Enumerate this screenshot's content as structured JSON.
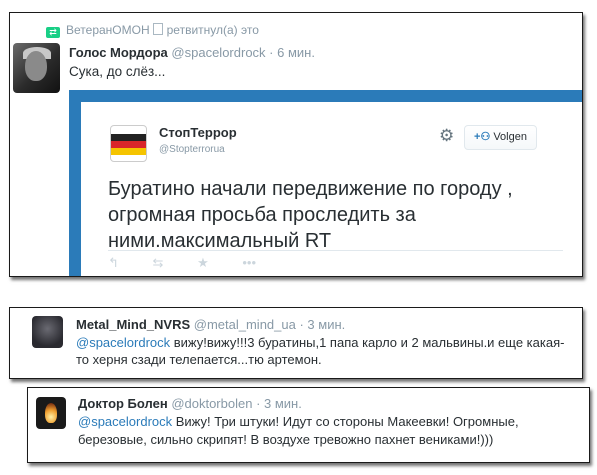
{
  "tweet1": {
    "retweeter_name": "ВетеранОМОН",
    "retweet_text": "ретвитнул(а) это",
    "author_name": "Голос Мордора",
    "author_handle": "@spacelordrock",
    "time": "· 6 мин.",
    "text": "Сука, до слёз..."
  },
  "embedded": {
    "author_name": "СтопТеррор",
    "author_handle": "@Stopterrorua",
    "follow_label": "Volgen",
    "text": "Буратино начали передвижение по городу , огромная просьба проследить за ними.максимальный RT",
    "icons": [
      "gear-icon",
      "add-user-icon",
      "reply-icon",
      "retweet-icon",
      "favorite-icon",
      "more-icon"
    ]
  },
  "tweet2": {
    "author_name": "Metal_Mind_NVRS",
    "author_handle": "@metal_mind_ua",
    "time": "· 3 мин.",
    "mention": "@spacelordrock",
    "text": " вижу!вижу!!!3 буратины,1 папа карло и 2 мальвины.и еще какая-то херня сзади телепается...тю артемон."
  },
  "tweet3": {
    "author_name": "Доктор Болен",
    "author_handle": "@doktorbolen",
    "time": "· 3 мин.",
    "mention": "@spacelordrock",
    "text": " Вижу! Три штуки! Идут со стороны Макеевки! Огромные, березовые, сильно скрипят! В воздухе тревожно пахнет вениками!)))"
  },
  "colors": {
    "link": "#2b7bb9",
    "muted": "#8899a6",
    "retweet": "#19cf86",
    "embed_border": "#2b7bb9"
  }
}
